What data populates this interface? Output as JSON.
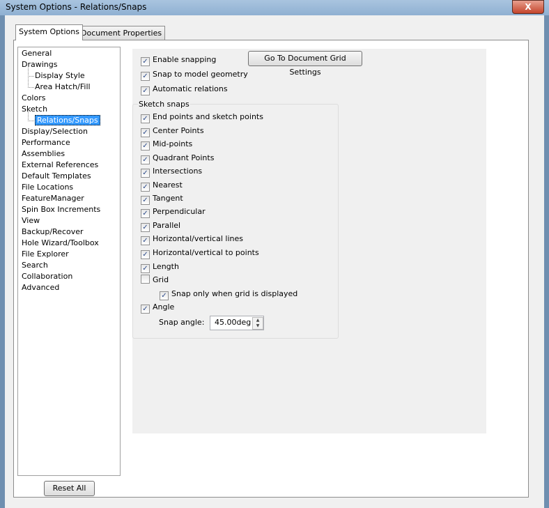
{
  "window": {
    "title": "System Options - Relations/Snaps",
    "close": "X"
  },
  "tabs": [
    {
      "label": "System Options",
      "active": true
    },
    {
      "label": "Document Properties",
      "active": false
    }
  ],
  "tree": [
    {
      "label": "General",
      "level": 0
    },
    {
      "label": "Drawings",
      "level": 0
    },
    {
      "label": "Display Style",
      "level": 1
    },
    {
      "label": "Area Hatch/Fill",
      "level": 1
    },
    {
      "label": "Colors",
      "level": 0
    },
    {
      "label": "Sketch",
      "level": 0
    },
    {
      "label": "Relations/Snaps",
      "level": 1,
      "selected": true
    },
    {
      "label": "Display/Selection",
      "level": 0
    },
    {
      "label": "Performance",
      "level": 0
    },
    {
      "label": "Assemblies",
      "level": 0
    },
    {
      "label": "External References",
      "level": 0
    },
    {
      "label": "Default Templates",
      "level": 0
    },
    {
      "label": "File Locations",
      "level": 0
    },
    {
      "label": "FeatureManager",
      "level": 0
    },
    {
      "label": "Spin Box Increments",
      "level": 0
    },
    {
      "label": "View",
      "level": 0
    },
    {
      "label": "Backup/Recover",
      "level": 0
    },
    {
      "label": "Hole Wizard/Toolbox",
      "level": 0
    },
    {
      "label": "File Explorer",
      "level": 0
    },
    {
      "label": "Search",
      "level": 0
    },
    {
      "label": "Collaboration",
      "level": 0
    },
    {
      "label": "Advanced",
      "level": 0
    }
  ],
  "top_options": [
    {
      "label": "Enable snapping",
      "checked": true
    },
    {
      "label": "Snap to model geometry",
      "checked": true
    },
    {
      "label": "Automatic relations",
      "checked": true
    }
  ],
  "grid_button": "Go To Document Grid Settings",
  "sketch_snaps": {
    "label": "Sketch snaps",
    "items": [
      {
        "label": "End points and sketch points",
        "checked": true
      },
      {
        "label": "Center Points",
        "checked": true
      },
      {
        "label": "Mid-points",
        "checked": true
      },
      {
        "label": "Quadrant Points",
        "checked": true
      },
      {
        "label": "Intersections",
        "checked": true
      },
      {
        "label": "Nearest",
        "checked": true
      },
      {
        "label": "Tangent",
        "checked": true
      },
      {
        "label": "Perpendicular",
        "checked": true
      },
      {
        "label": "Parallel",
        "checked": true
      },
      {
        "label": "Horizontal/vertical lines",
        "checked": true
      },
      {
        "label": "Horizontal/vertical to points",
        "checked": true
      },
      {
        "label": "Length",
        "checked": true
      },
      {
        "label": "Grid",
        "checked": false
      },
      {
        "label": "Snap only when grid is displayed",
        "checked": true,
        "indent": true
      },
      {
        "label": "Angle",
        "checked": true
      }
    ]
  },
  "snap_angle": {
    "label": "Snap angle:",
    "value": "45.00deg"
  },
  "reset_button": "Reset All",
  "check_glyph": "✓"
}
